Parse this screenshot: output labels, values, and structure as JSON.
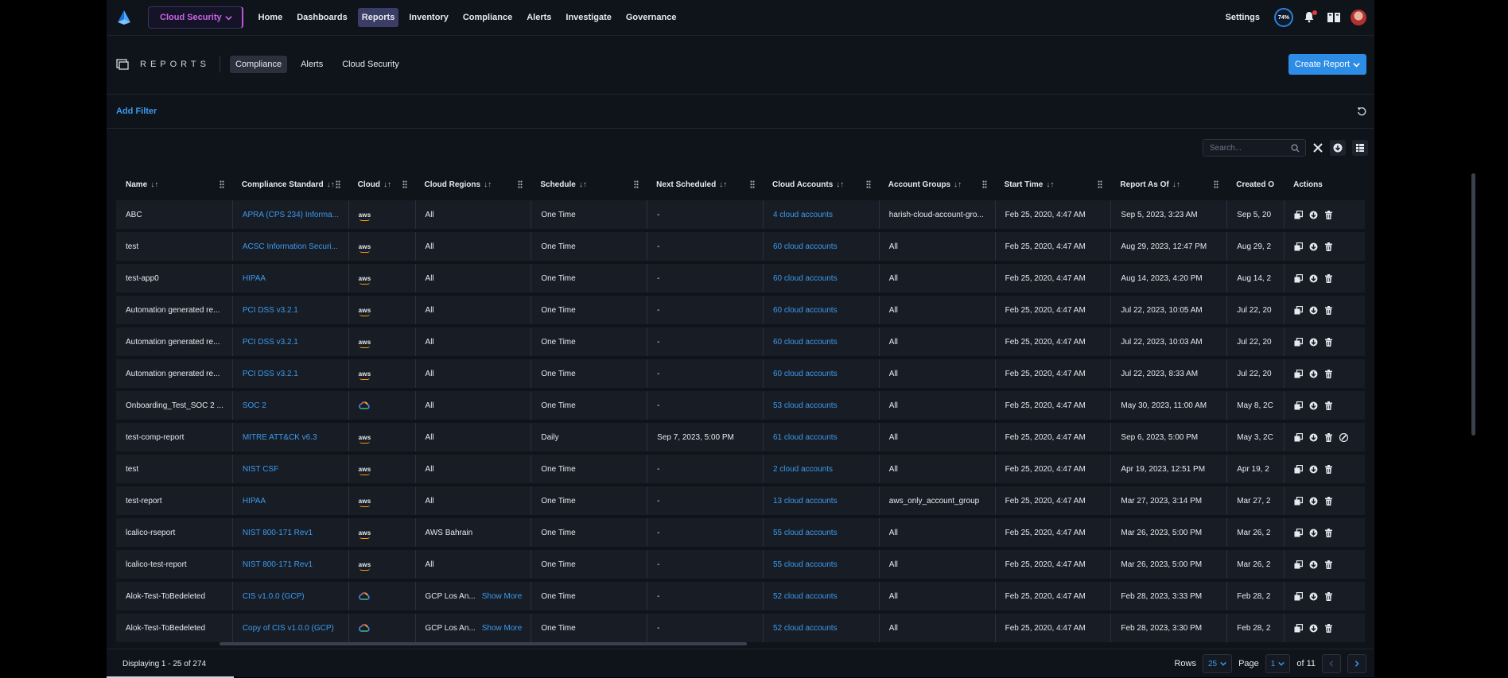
{
  "nav": {
    "context_label": "Cloud Security",
    "items": [
      "Home",
      "Dashboards",
      "Reports",
      "Inventory",
      "Compliance",
      "Alerts",
      "Investigate",
      "Governance"
    ],
    "active_item": "Reports",
    "settings_label": "Settings",
    "score_label": "74%"
  },
  "reports": {
    "title": "REPORTS",
    "tabs": [
      "Compliance",
      "Alerts",
      "Cloud Security"
    ],
    "active_tab": "Compliance",
    "create_label": "Create Report"
  },
  "filter": {
    "add_label": "Add Filter"
  },
  "toolbar": {
    "search_placeholder": "Search..."
  },
  "table": {
    "columns": [
      "Name",
      "Compliance Standard",
      "Cloud",
      "Cloud Regions",
      "Schedule",
      "Next Scheduled",
      "Cloud Accounts",
      "Account Groups",
      "Start Time",
      "Report As Of",
      "Created O",
      "Actions"
    ],
    "rows": [
      {
        "name": "ABC",
        "standard": "APRA (CPS 234) Informa...",
        "cloud": "aws",
        "regions": "All",
        "show_more": "",
        "schedule": "One Time",
        "next": "-",
        "accounts": "4 cloud accounts",
        "groups": "harish-cloud-account-gro...",
        "start": "Feb 25, 2020, 4:47 AM",
        "asof": "Sep 5, 2023, 3:23 AM",
        "created": "Sep 5, 20",
        "extra_action": false
      },
      {
        "name": "test",
        "standard": "ACSC Information Securi...",
        "cloud": "aws",
        "regions": "All",
        "show_more": "",
        "schedule": "One Time",
        "next": "-",
        "accounts": "60 cloud accounts",
        "groups": "All",
        "start": "Feb 25, 2020, 4:47 AM",
        "asof": "Aug 29, 2023, 12:47 PM",
        "created": "Aug 29, 2",
        "extra_action": false
      },
      {
        "name": "test-app0",
        "standard": "HIPAA",
        "cloud": "aws",
        "regions": "All",
        "show_more": "",
        "schedule": "One Time",
        "next": "-",
        "accounts": "60 cloud accounts",
        "groups": "All",
        "start": "Feb 25, 2020, 4:47 AM",
        "asof": "Aug 14, 2023, 4:20 PM",
        "created": "Aug 14, 2",
        "extra_action": false
      },
      {
        "name": "Automation generated re...",
        "standard": "PCI DSS v3.2.1",
        "cloud": "aws",
        "regions": "All",
        "show_more": "",
        "schedule": "One Time",
        "next": "-",
        "accounts": "60 cloud accounts",
        "groups": "All",
        "start": "Feb 25, 2020, 4:47 AM",
        "asof": "Jul 22, 2023, 10:05 AM",
        "created": "Jul 22, 20",
        "extra_action": false
      },
      {
        "name": "Automation generated re...",
        "standard": "PCI DSS v3.2.1",
        "cloud": "aws",
        "regions": "All",
        "show_more": "",
        "schedule": "One Time",
        "next": "-",
        "accounts": "60 cloud accounts",
        "groups": "All",
        "start": "Feb 25, 2020, 4:47 AM",
        "asof": "Jul 22, 2023, 10:03 AM",
        "created": "Jul 22, 20",
        "extra_action": false
      },
      {
        "name": "Automation generated re...",
        "standard": "PCI DSS v3.2.1",
        "cloud": "aws",
        "regions": "All",
        "show_more": "",
        "schedule": "One Time",
        "next": "-",
        "accounts": "60 cloud accounts",
        "groups": "All",
        "start": "Feb 25, 2020, 4:47 AM",
        "asof": "Jul 22, 2023, 8:33 AM",
        "created": "Jul 22, 20",
        "extra_action": false
      },
      {
        "name": "Onboarding_Test_SOC 2 ...",
        "standard": "SOC 2",
        "cloud": "gcp",
        "regions": "All",
        "show_more": "",
        "schedule": "One Time",
        "next": "-",
        "accounts": "53 cloud accounts",
        "groups": "All",
        "start": "Feb 25, 2020, 4:47 AM",
        "asof": "May 30, 2023, 11:00 AM",
        "created": "May 8, 2C",
        "extra_action": false
      },
      {
        "name": "test-comp-report",
        "standard": "MITRE ATT&CK v6.3",
        "cloud": "aws",
        "regions": "All",
        "show_more": "",
        "schedule": "Daily",
        "next": "Sep 7, 2023, 5:00 PM",
        "accounts": "61 cloud accounts",
        "groups": "All",
        "start": "Feb 25, 2020, 4:47 AM",
        "asof": "Sep 6, 2023, 5:00 PM",
        "created": "May 3, 2C",
        "extra_action": true
      },
      {
        "name": "test",
        "standard": "NIST CSF",
        "cloud": "aws",
        "regions": "All",
        "show_more": "",
        "schedule": "One Time",
        "next": "-",
        "accounts": "2 cloud accounts",
        "groups": "All",
        "start": "Feb 25, 2020, 4:47 AM",
        "asof": "Apr 19, 2023, 12:51 PM",
        "created": "Apr 19, 2",
        "extra_action": false
      },
      {
        "name": "test-report",
        "standard": "HIPAA",
        "cloud": "aws",
        "regions": "All",
        "show_more": "",
        "schedule": "One Time",
        "next": "-",
        "accounts": "13 cloud accounts",
        "groups": "aws_only_account_group",
        "start": "Feb 25, 2020, 4:47 AM",
        "asof": "Mar 27, 2023, 3:14 PM",
        "created": "Mar 27, 2",
        "extra_action": false
      },
      {
        "name": "lcalico-rseport",
        "standard": "NIST 800-171 Rev1",
        "cloud": "aws",
        "regions": "AWS Bahrain",
        "show_more": "",
        "schedule": "One Time",
        "next": "-",
        "accounts": "55 cloud accounts",
        "groups": "All",
        "start": "Feb 25, 2020, 4:47 AM",
        "asof": "Mar 26, 2023, 5:00 PM",
        "created": "Mar 26, 2",
        "extra_action": false
      },
      {
        "name": "lcalico-test-report",
        "standard": "NIST 800-171 Rev1",
        "cloud": "aws",
        "regions": "All",
        "show_more": "",
        "schedule": "One Time",
        "next": "-",
        "accounts": "55 cloud accounts",
        "groups": "All",
        "start": "Feb 25, 2020, 4:47 AM",
        "asof": "Mar 26, 2023, 5:00 PM",
        "created": "Mar 26, 2",
        "extra_action": false
      },
      {
        "name": "Alok-Test-ToBedeleted",
        "standard": "CIS v1.0.0 (GCP)",
        "cloud": "gcp",
        "regions": "GCP Los An...",
        "show_more": "Show More",
        "schedule": "One Time",
        "next": "-",
        "accounts": "52 cloud accounts",
        "groups": "All",
        "start": "Feb 25, 2020, 4:47 AM",
        "asof": "Feb 28, 2023, 3:33 PM",
        "created": "Feb 28, 2",
        "extra_action": false
      },
      {
        "name": "Alok-Test-ToBedeleted",
        "standard": "Copy of CIS v1.0.0 (GCP)",
        "cloud": "gcp",
        "regions": "GCP Los An...",
        "show_more": "Show More",
        "schedule": "One Time",
        "next": "-",
        "accounts": "52 cloud accounts",
        "groups": "All",
        "start": "Feb 25, 2020, 4:47 AM",
        "asof": "Feb 28, 2023, 3:30 PM",
        "created": "Feb 28, 2",
        "extra_action": false
      }
    ]
  },
  "footer": {
    "displaying": "Displaying 1 - 25 of 274",
    "rows_label": "Rows",
    "rows_value": "25",
    "page_label": "Page",
    "page_value": "1",
    "of_label": "of 11"
  },
  "colors": {
    "accent": "#2c8ce6",
    "link": "#3b9af0",
    "context": "#c865e6",
    "background": "#0f131a",
    "row": "#181d25"
  },
  "icons": [
    "prisma-logo-icon",
    "chevron-down-icon",
    "score-ring-icon",
    "bell-icon",
    "docs-icon",
    "avatar",
    "reports-icon",
    "reset-icon",
    "search-icon",
    "close-icon",
    "download-icon",
    "columns-icon",
    "sort-icon",
    "drag-handle-icon",
    "aws-icon",
    "gcp-icon",
    "copy-icon",
    "trash-icon",
    "edit-icon",
    "chevron-left-icon",
    "chevron-right-icon"
  ]
}
